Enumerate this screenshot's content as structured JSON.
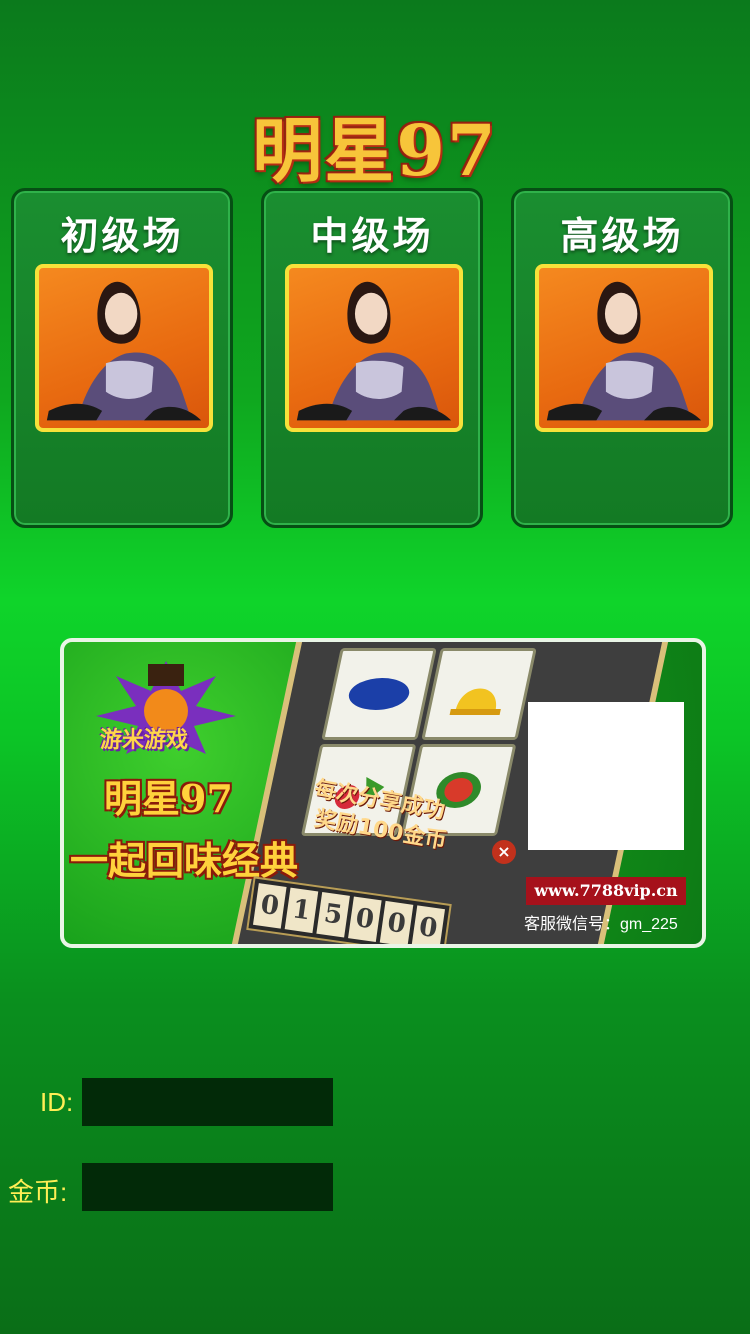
{
  "title": "明星97",
  "rooms": [
    {
      "label": "初级场"
    },
    {
      "label": "中级场"
    },
    {
      "label": "高级场"
    }
  ],
  "banner": {
    "logo_text": "游米游戏",
    "promo_line1": "明星97",
    "promo_line2": "一起回味经典",
    "reward_line1": "每次分享成功",
    "reward_line2": "奖励100金币",
    "counter_digits": [
      "0",
      "1",
      "5",
      "0",
      "0",
      "0"
    ],
    "url": "www.7788vip.cn",
    "service": "客服微信号：gm_225"
  },
  "fields": {
    "id_label": "ID:",
    "id_value": "",
    "coin_label": "金币:",
    "coin_value": ""
  },
  "colors": {
    "background_green": "#0fd42a",
    "room_frame": "#064f14",
    "avatar_border": "#f6e23a",
    "field_bg": "#022a08",
    "label_yellow": "#ffee55"
  }
}
